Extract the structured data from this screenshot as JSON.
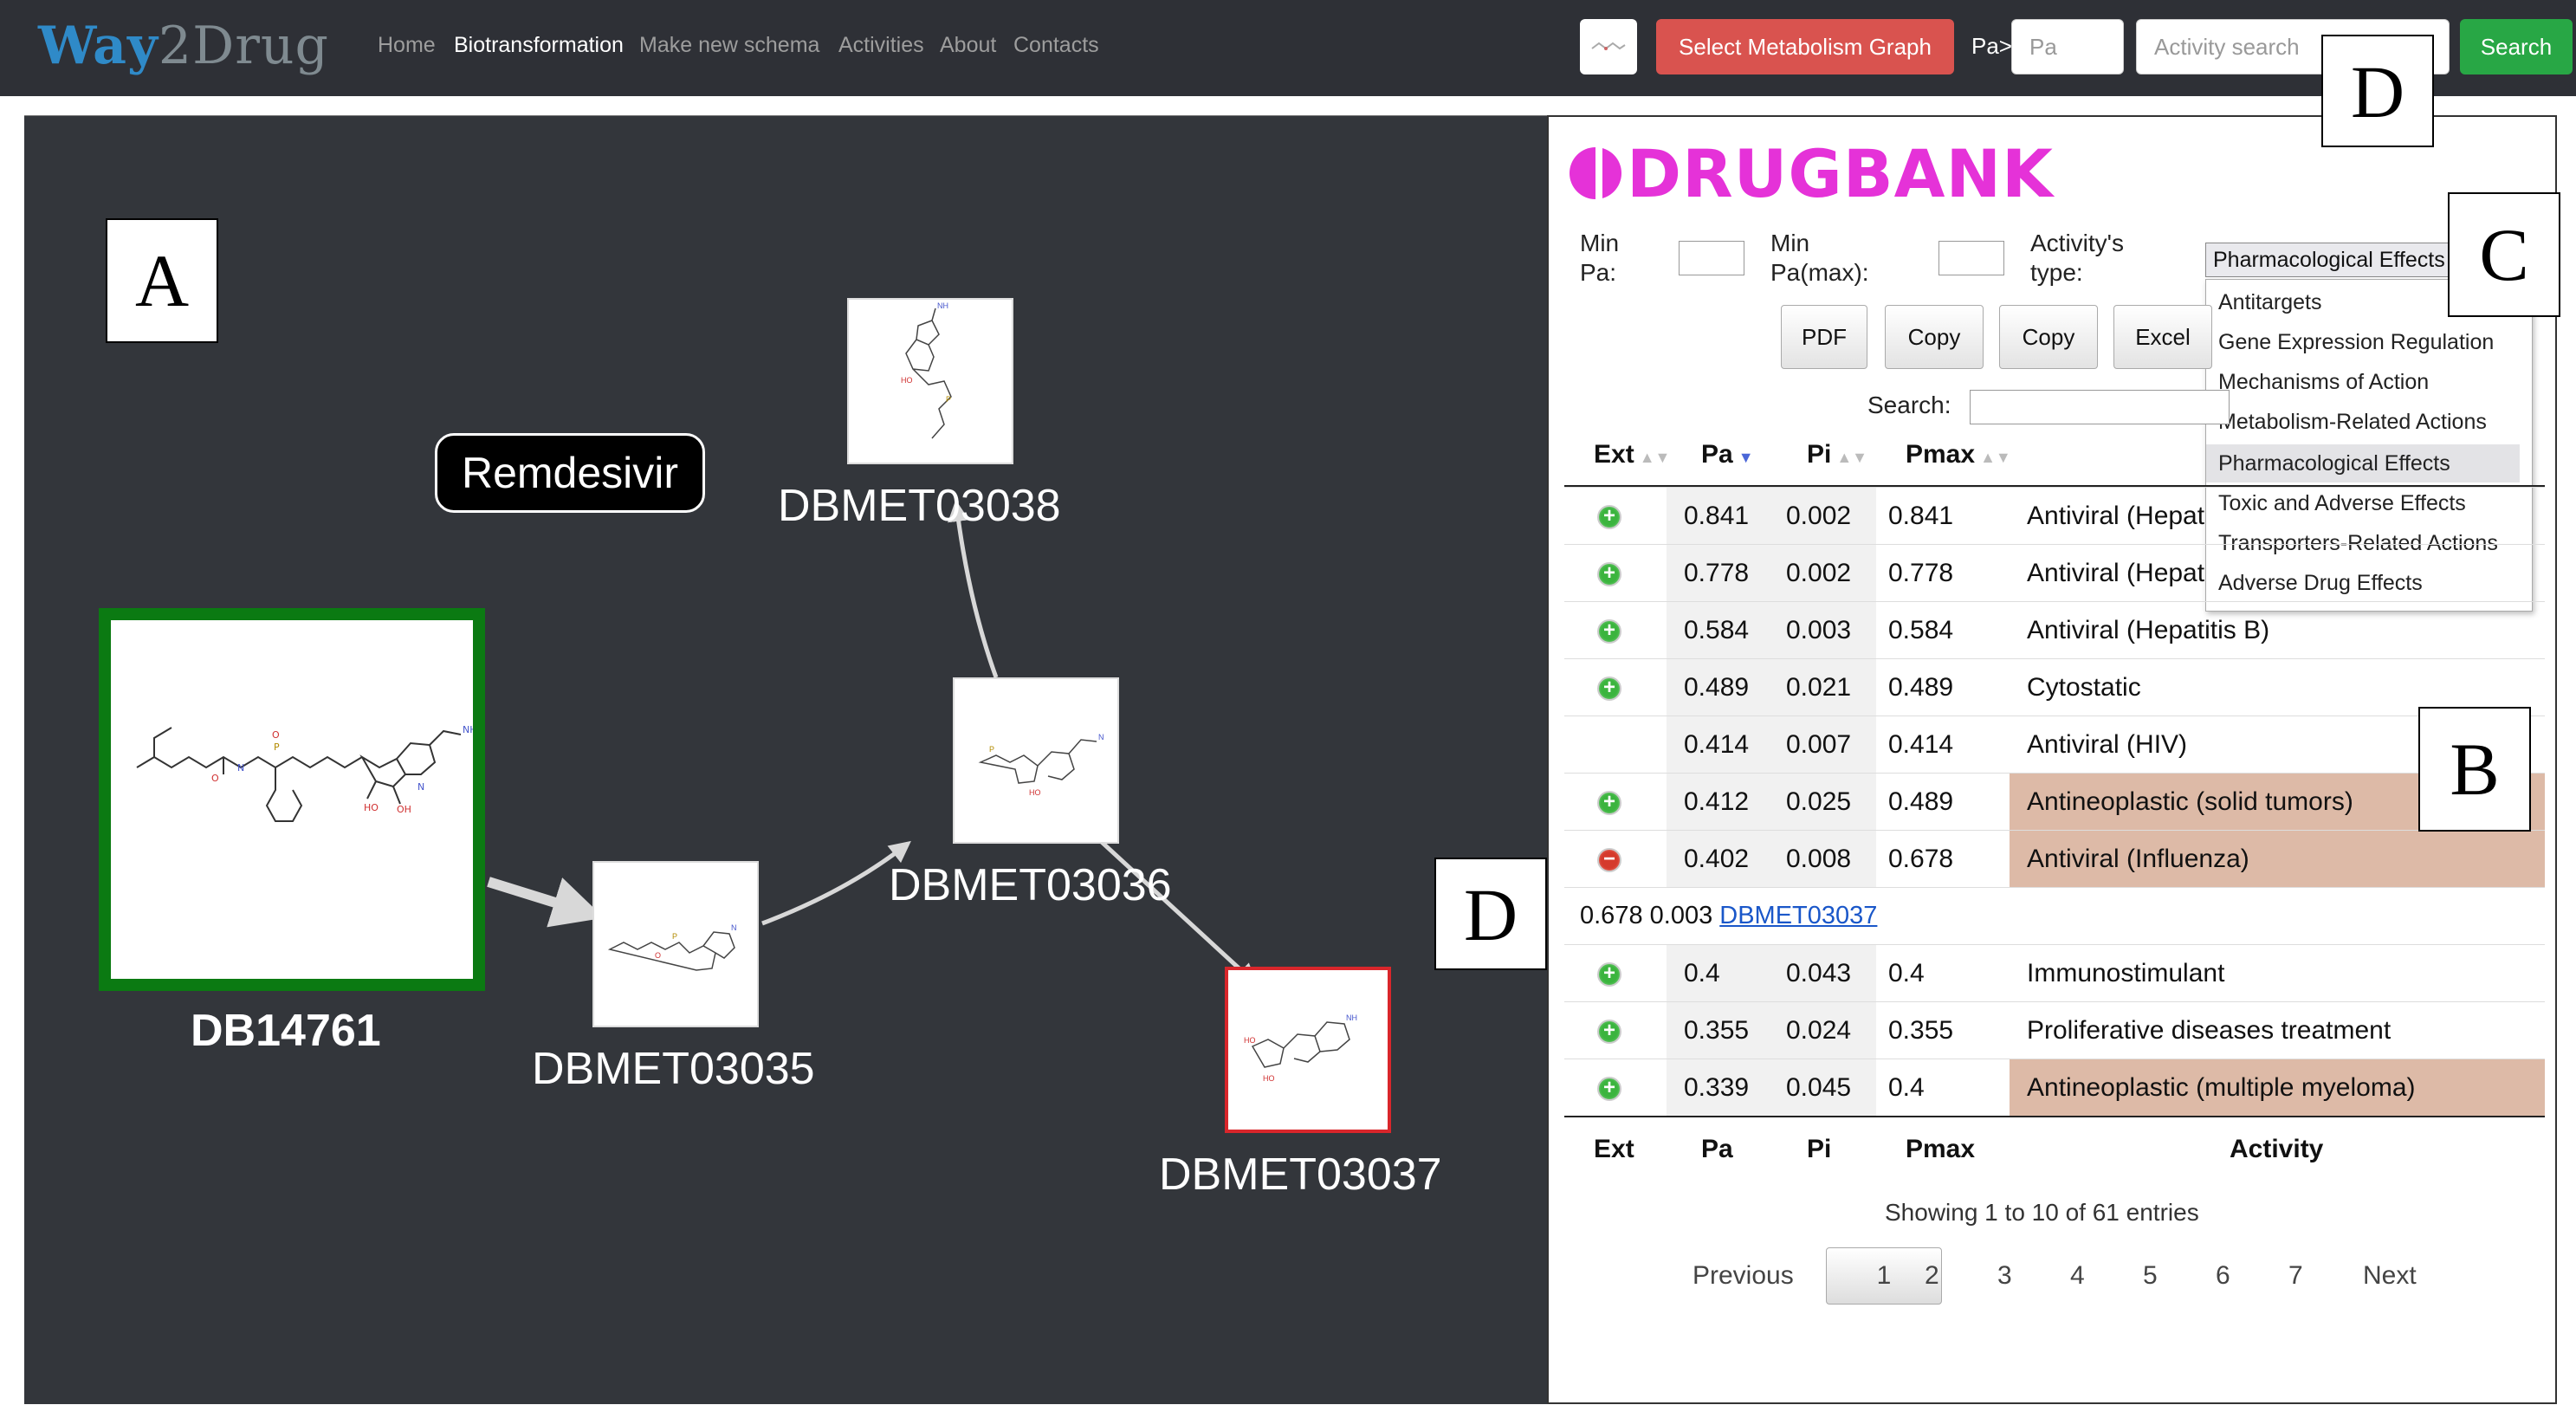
{
  "navbar": {
    "brand_part1": "Way",
    "brand_part2": "2Drug",
    "links": [
      "Home",
      "Biotransformation",
      "Make new schema",
      "Activities",
      "About",
      "Contacts"
    ],
    "select_graph_label": "Select Metabolism Graph",
    "pa_label": "Pa>",
    "pa_placeholder": "Pa",
    "activity_placeholder": "Activity search",
    "search_label": "Search"
  },
  "panel_letters": {
    "a": "A",
    "b": "B",
    "c": "C",
    "d_top": "D",
    "d_mid": "D"
  },
  "graph": {
    "drug_name": "Remdesivir",
    "nodes": {
      "root": "DB14761",
      "m35": "DBMET03035",
      "m36": "DBMET03036",
      "m37": "DBMET03037",
      "m38": "DBMET03038"
    }
  },
  "drugbank": {
    "logo_text": "DRUGBANK",
    "min_pa_label": "Min Pa:",
    "min_pamax_label": "Min Pa(max):",
    "activity_type_label": "Activity's type:",
    "selected_type": "Pharmacological Effects",
    "type_options": [
      "Antitargets",
      "Gene Expression Regulation",
      "Mechanisms of Action",
      "Metabolism-Related Actions",
      "Pharmacological Effects",
      "Toxic and Adverse Effects",
      "Transporters-Related Actions",
      "Adverse Drug Effects"
    ],
    "buttons": [
      "PDF",
      "Copy",
      "Copy",
      "Excel"
    ],
    "search_label": "Search:",
    "columns": [
      "Ext",
      "Pa",
      "Pi",
      "Pmax",
      "Activity"
    ],
    "rows": [
      {
        "pa": "0.841",
        "pi": "0.002",
        "pmax": "0.841",
        "activity": "Antiviral (Hepat"
      },
      {
        "pa": "0.778",
        "pi": "0.002",
        "pmax": "0.778",
        "activity": "Antiviral (Hepat"
      },
      {
        "pa": "0.584",
        "pi": "0.003",
        "pmax": "0.584",
        "activity": "Antiviral (Hepatitis B)"
      },
      {
        "pa": "0.489",
        "pi": "0.021",
        "pmax": "0.489",
        "activity": "Cytostatic"
      },
      {
        "pa": "0.414",
        "pi": "0.007",
        "pmax": "0.414",
        "activity": "Antiviral (HIV)"
      },
      {
        "pa": "0.412",
        "pi": "0.025",
        "pmax": "0.489",
        "activity": "Antineoplastic (solid tumors)"
      },
      {
        "pa": "0.402",
        "pi": "0.008",
        "pmax": "0.678",
        "activity": "Antiviral (Influenza)"
      },
      {
        "pa": "0.4",
        "pi": "0.043",
        "pmax": "0.4",
        "activity": "Immunostimulant"
      },
      {
        "pa": "0.355",
        "pi": "0.024",
        "pmax": "0.355",
        "activity": "Proliferative diseases treatment"
      },
      {
        "pa": "0.339",
        "pi": "0.045",
        "pmax": "0.4",
        "activity": "Antineoplastic (multiple myeloma)"
      }
    ],
    "detail_values": "0.678 0.003",
    "detail_link": "DBMET03037",
    "info": "Showing 1 to 10 of 61 entries",
    "pagination": {
      "previous": "Previous",
      "pages": [
        "1",
        "2",
        "3",
        "4",
        "5",
        "6",
        "7"
      ],
      "next": "Next"
    }
  },
  "colors": {
    "navbar_bg": "#2e3036",
    "graph_bg": "#33363b",
    "root_border": "#0b7a12",
    "highlight_border": "#d9262b",
    "drugbank_pink": "#e532d8",
    "highlight_row": "#ddbaa7",
    "search_btn": "#28a745",
    "select_btn": "#d9534f"
  }
}
